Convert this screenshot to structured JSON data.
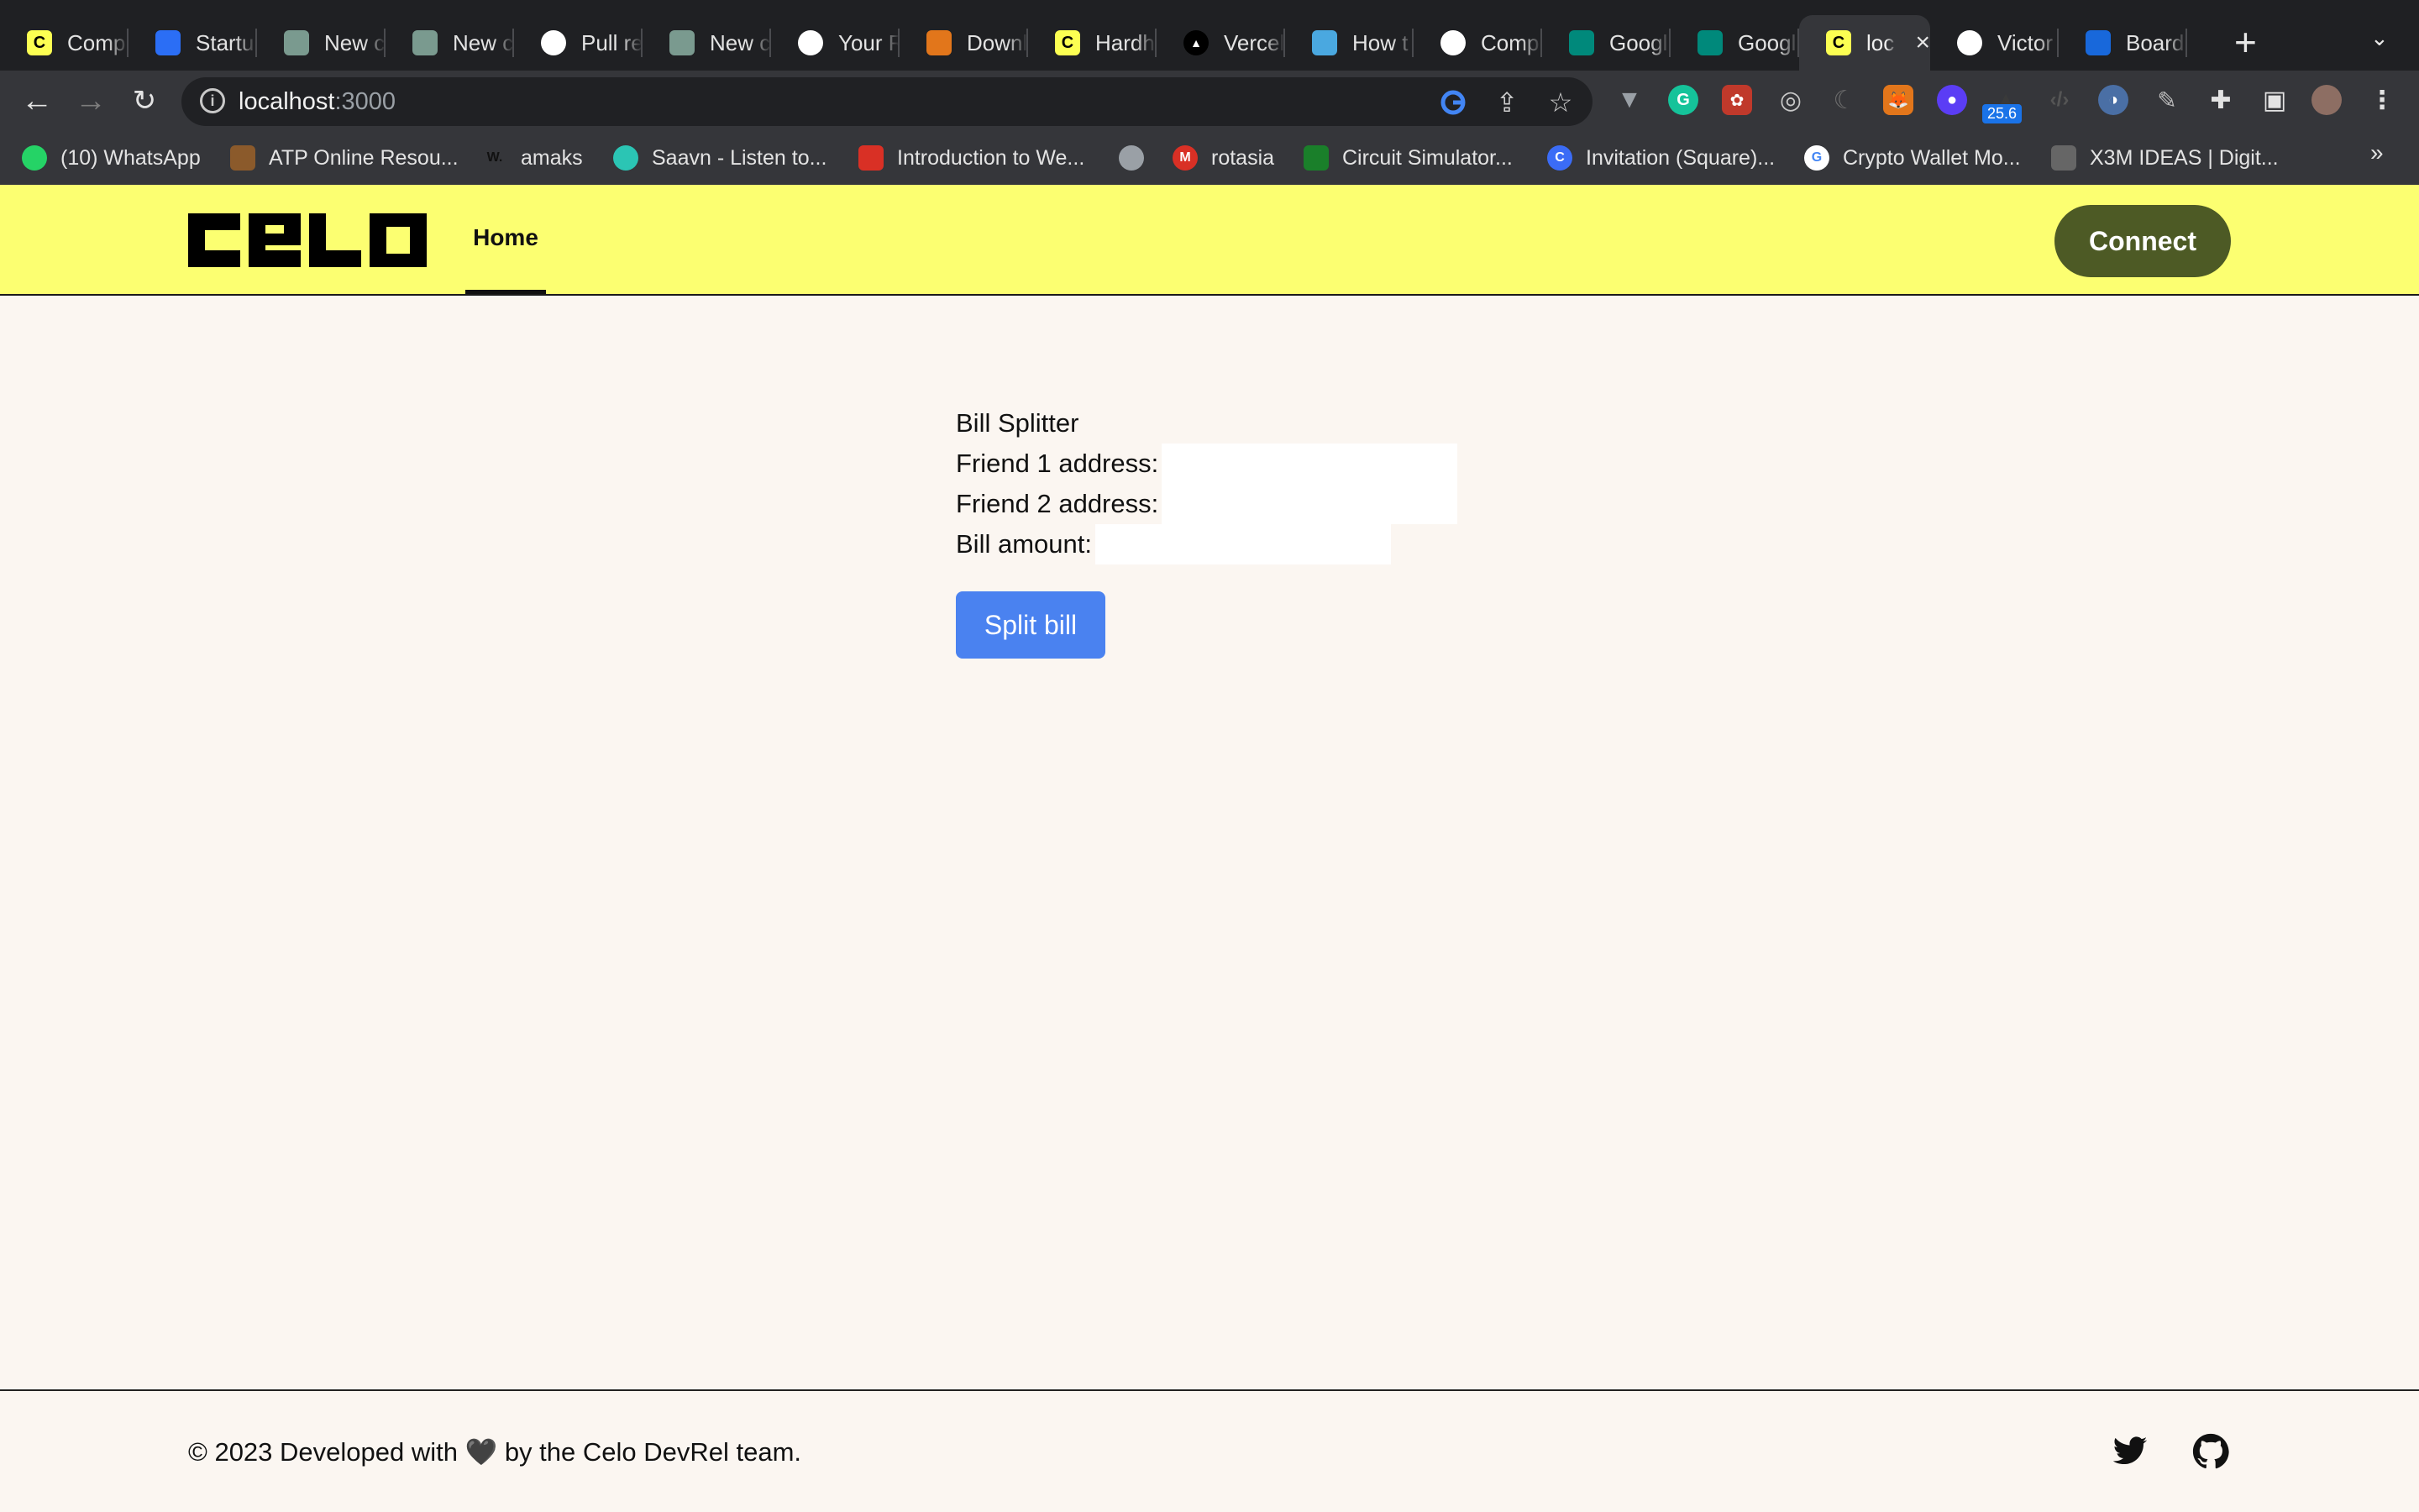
{
  "browser": {
    "tabs": [
      {
        "title": "Comp",
        "favicon": "celo-icon",
        "color": "#fcff52"
      },
      {
        "title": "Startu",
        "favicon": "shield-icon",
        "color": "#2b6ef5"
      },
      {
        "title": "New c",
        "favicon": "openai-icon",
        "color": "#7a9a8f"
      },
      {
        "title": "New c",
        "favicon": "openai-icon",
        "color": "#7a9a8f"
      },
      {
        "title": "Pull re",
        "favicon": "github-icon",
        "color": "#ffffff"
      },
      {
        "title": "New c",
        "favicon": "openai-icon",
        "color": "#7a9a8f"
      },
      {
        "title": "Your R",
        "favicon": "github-icon",
        "color": "#ffffff"
      },
      {
        "title": "Downl",
        "favicon": "metamask-icon",
        "color": "#e2761b"
      },
      {
        "title": "Hardh",
        "favicon": "hardhat-icon",
        "color": "#fcff52"
      },
      {
        "title": "Vercel",
        "favicon": "vercel-icon",
        "color": "#000000"
      },
      {
        "title": "How t",
        "favicon": "snowflake-icon",
        "color": "#4aa8e0"
      },
      {
        "title": "Comp",
        "favicon": "github-icon",
        "color": "#ffffff"
      },
      {
        "title": "Googl",
        "favicon": "google-meet-icon",
        "color": "#00897b"
      },
      {
        "title": "Googl",
        "favicon": "google-meet-icon",
        "color": "#00897b"
      },
      {
        "title": "loc",
        "favicon": "celo-icon",
        "color": "#fcff52",
        "active": true
      },
      {
        "title": "Victor",
        "favicon": "github-icon",
        "color": "#ffffff"
      },
      {
        "title": "Board",
        "favicon": "trello-icon",
        "color": "#1868db"
      }
    ],
    "url": {
      "host": "localhost",
      "port": ":3000"
    },
    "bookmarks": [
      {
        "label": "(10) WhatsApp",
        "icon": "whatsapp-icon",
        "color": "#25d366"
      },
      {
        "label": "ATP Online Resou...",
        "icon": "atp-icon",
        "color": "#8b5a2b"
      },
      {
        "label": "amaks",
        "icon": "w-icon",
        "color": "#111111"
      },
      {
        "label": "Saavn - Listen to...",
        "icon": "saavn-icon",
        "color": "#2bc5b4"
      },
      {
        "label": "Introduction to We...",
        "icon": "code-icon",
        "color": "#d93025"
      },
      {
        "label": "",
        "icon": "globe-icon",
        "color": "#9aa0a6"
      },
      {
        "label": "rotasia",
        "icon": "m-icon",
        "color": "#d93025"
      },
      {
        "label": "Circuit Simulator...",
        "icon": "circuit-icon",
        "color": "#1a7f2a"
      },
      {
        "label": "Invitation (Square)...",
        "icon": "c-icon",
        "color": "#3b6cf6"
      },
      {
        "label": "Crypto Wallet Mo...",
        "icon": "google-icon",
        "color": "#ffffff"
      },
      {
        "label": "X3M IDEAS | Digit...",
        "icon": "x3m-icon",
        "color": "#666666"
      }
    ],
    "extension_badge": "25.6"
  },
  "site": {
    "logo_text": "CELO",
    "nav": {
      "home": "Home"
    },
    "connect_label": "Connect",
    "accent_color": "#fcff71",
    "connect_color": "#4d5a25"
  },
  "form": {
    "title": "Bill Splitter",
    "friend1_label": "Friend 1 address:",
    "friend1_value": "",
    "friend2_label": "Friend 2 address:",
    "friend2_value": "",
    "amount_label": "Bill amount:",
    "amount_value": "",
    "submit_label": "Split bill",
    "submit_color": "#4a82f0"
  },
  "footer": {
    "copyright": "© 2023 Developed with 🖤 by the Celo DevRel team.",
    "social": [
      "twitter-icon",
      "github-icon"
    ]
  }
}
